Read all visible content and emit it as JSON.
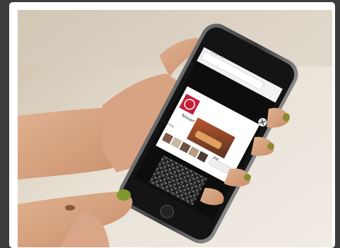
{
  "photo": {
    "subject": "hand-holding-smartphone-showing-ad",
    "screen": {
      "url_text": "ニュース",
      "ad_brand": "Nissan",
      "ad_cta": "おすすめ",
      "bottom_cta": "詳細"
    }
  }
}
